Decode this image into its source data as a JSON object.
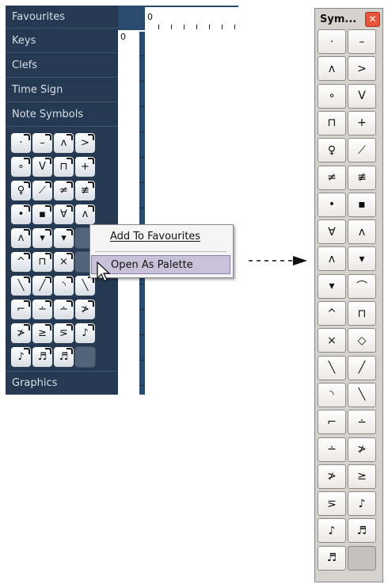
{
  "inspector": {
    "categories": {
      "favourites": "Favourites",
      "keys": "Keys",
      "clefs": "Clefs",
      "time_sign": "Time Sign",
      "note_symbols": "Note Symbols",
      "graphics": "Graphics"
    },
    "symbol_grid": [
      {
        "glyph": "·",
        "icon": "staccato-icon"
      },
      {
        "glyph": "–",
        "icon": "tenuto-icon"
      },
      {
        "glyph": "ʌ",
        "icon": "marcato-icon"
      },
      {
        "glyph": ">",
        "icon": "accent-icon"
      },
      {
        "glyph": "∘",
        "icon": "harmonic-icon"
      },
      {
        "glyph": "V",
        "icon": "up-bow-icon"
      },
      {
        "glyph": "⊓",
        "icon": "down-bow-icon"
      },
      {
        "glyph": "+",
        "icon": "stopped-icon"
      },
      {
        "glyph": "♀",
        "icon": "thumb-position-icon"
      },
      {
        "glyph": "⟋",
        "icon": "tremolo-1-icon"
      },
      {
        "glyph": "≠",
        "icon": "tremolo-2-icon"
      },
      {
        "glyph": "≢",
        "icon": "tremolo-3-icon"
      },
      {
        "glyph": "•",
        "icon": "dot-icon"
      },
      {
        "glyph": "▪",
        "icon": "square-dot-icon"
      },
      {
        "glyph": "∀",
        "icon": "marcato-staccato-icon"
      },
      {
        "glyph": "ʌ",
        "icon": "marcato-alt-icon"
      },
      {
        "glyph": "ʌ",
        "icon": "marcato-dot-icon"
      },
      {
        "glyph": "▾",
        "icon": "wedge-icon"
      },
      {
        "glyph": "▾",
        "icon": "staccatissimo-icon"
      },
      {
        "glyph": "",
        "icon": "empty"
      },
      {
        "glyph": "^",
        "icon": "short-fermata-icon"
      },
      {
        "glyph": "⊓",
        "icon": "square-fermata-icon"
      },
      {
        "glyph": "×",
        "icon": "cross-icon"
      },
      {
        "glyph": "",
        "icon": "empty"
      },
      {
        "glyph": "╲",
        "icon": "fall-icon"
      },
      {
        "glyph": "╱",
        "icon": "rise-icon"
      },
      {
        "glyph": "◝",
        "icon": "bend-icon"
      },
      {
        "glyph": "╲",
        "icon": "glissando-icon"
      },
      {
        "glyph": "⌐",
        "icon": "scoop-icon"
      },
      {
        "glyph": "∸",
        "icon": "tenuto-staccato-icon"
      },
      {
        "glyph": "∸",
        "icon": "tenuto-staccato-below-icon"
      },
      {
        "glyph": "≯",
        "icon": "accent-staccato-icon"
      },
      {
        "glyph": "≯",
        "icon": "accent-tenuto-icon"
      },
      {
        "glyph": "≥",
        "icon": "accent-tenuto-alt-icon"
      },
      {
        "glyph": "⋝",
        "icon": "accent-dot-tenuto-icon"
      },
      {
        "glyph": "♪",
        "icon": "grace-note-icon"
      },
      {
        "glyph": "♪",
        "icon": "eighth-note-icon"
      },
      {
        "glyph": "♬",
        "icon": "sixteenth-note-icon"
      },
      {
        "glyph": "♬",
        "icon": "thirtysecond-note-icon"
      },
      {
        "glyph": "",
        "icon": "empty"
      }
    ]
  },
  "ruler": {
    "h_zero": "0",
    "v_zero": "0"
  },
  "context_menu": {
    "items": [
      {
        "label": "Add To Favourites",
        "selected": false
      },
      {
        "label": "Open As Palette",
        "selected": true
      }
    ]
  },
  "palette": {
    "title": "Sym...",
    "close_glyph": "✕",
    "symbols": [
      "·",
      "–",
      "ʌ",
      ">",
      "∘",
      "V",
      "⊓",
      "+",
      "♀",
      "⟋",
      "≠",
      "≢",
      "•",
      "▪",
      "∀",
      "ʌ",
      "ʌ",
      "▾",
      "▾",
      "⌒",
      "^",
      "⊓",
      "×",
      "◇",
      "╲",
      "╱",
      "◝",
      "╲",
      "⌐",
      "∸",
      "∸",
      "≯",
      "≯",
      "≥",
      "⋝",
      "♪",
      "♪",
      "♬",
      "♬",
      ""
    ]
  },
  "colors": {
    "inspector_bg": "#253a52",
    "canvas_bg": "#2a4a6e",
    "menu_highlight": "#c8c2d8",
    "close_button": "#e8553b"
  }
}
